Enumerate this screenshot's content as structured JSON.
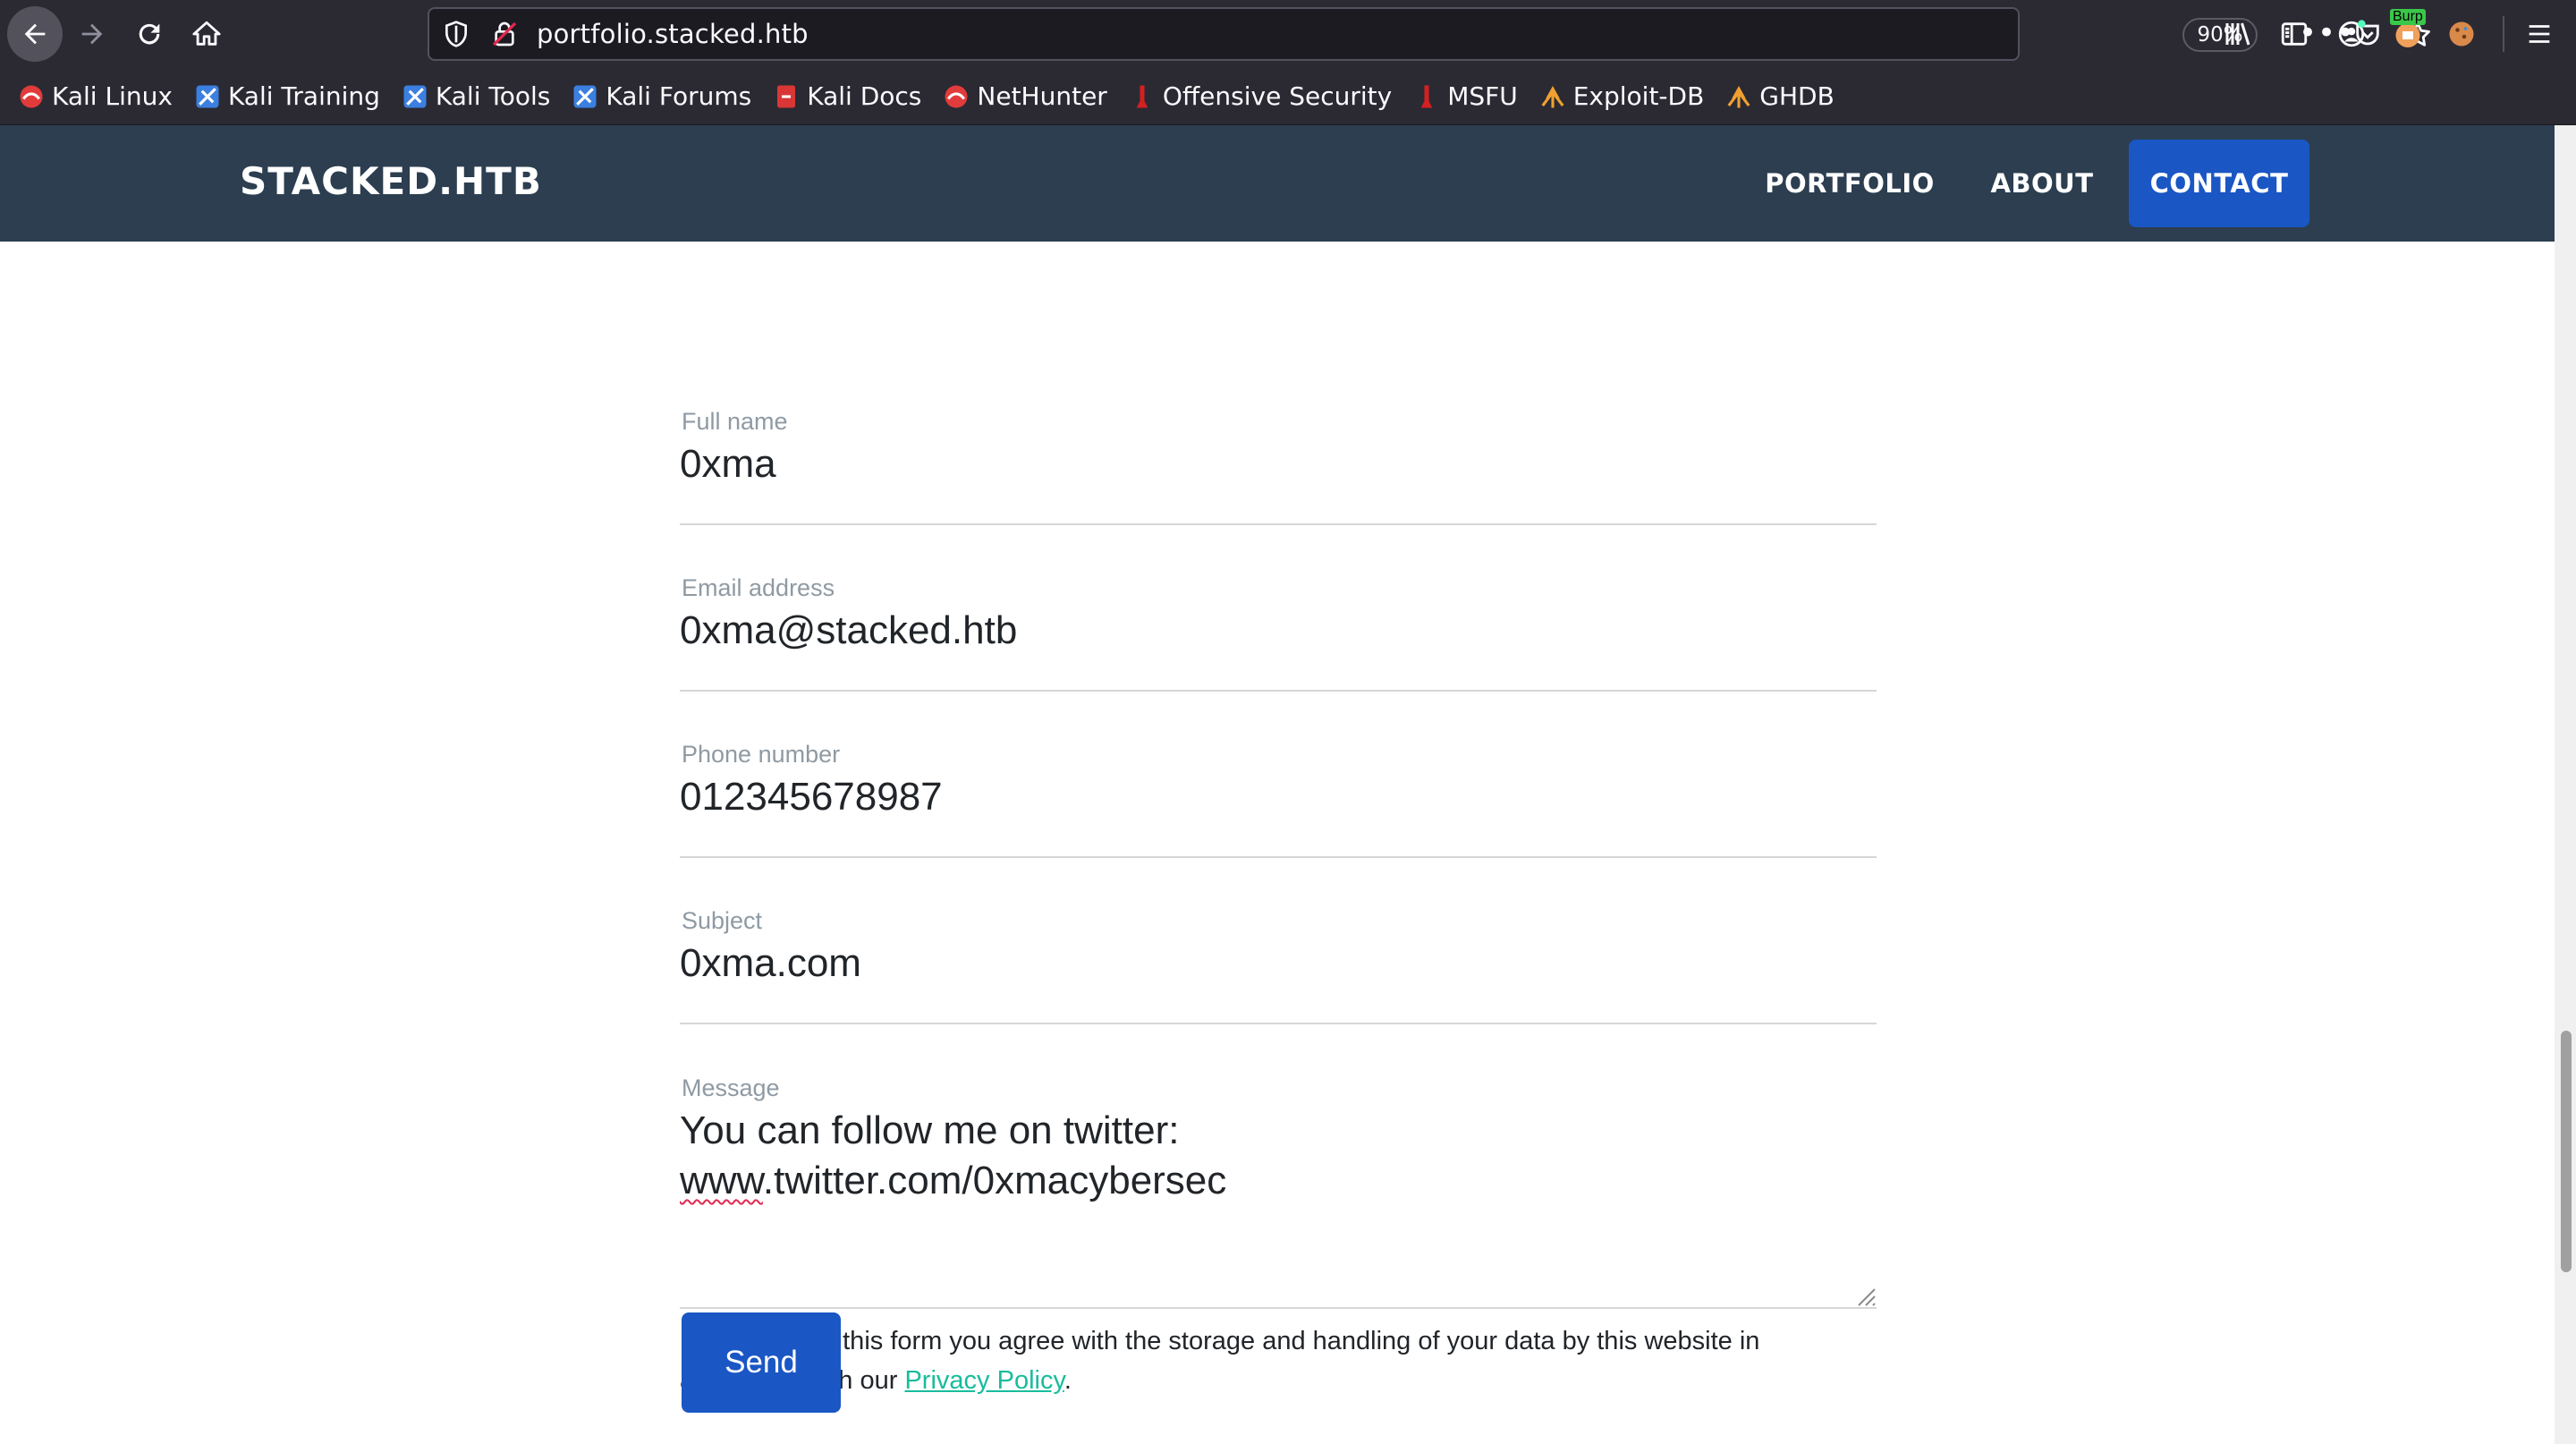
{
  "browser": {
    "url": "portfolio.stacked.htb",
    "zoom": "90%",
    "burp_badge": "Burp",
    "bookmarks": [
      {
        "label": "Kali Linux",
        "icon": "kali-dragon-icon"
      },
      {
        "label": "Kali Training",
        "icon": "kali-training-icon"
      },
      {
        "label": "Kali Tools",
        "icon": "kali-tools-icon"
      },
      {
        "label": "Kali Forums",
        "icon": "kali-forums-icon"
      },
      {
        "label": "Kali Docs",
        "icon": "kali-docs-icon"
      },
      {
        "label": "NetHunter",
        "icon": "nethunter-icon"
      },
      {
        "label": "Offensive Security",
        "icon": "offsec-icon"
      },
      {
        "label": "MSFU",
        "icon": "msfu-icon"
      },
      {
        "label": "Exploit-DB",
        "icon": "exploit-db-icon"
      },
      {
        "label": "GHDB",
        "icon": "ghdb-icon"
      }
    ]
  },
  "site": {
    "brand": "STACKED.HTB",
    "nav": [
      {
        "label": "PORTFOLIO"
      },
      {
        "label": "ABOUT"
      },
      {
        "label": "CONTACT"
      }
    ],
    "colors": {
      "navbar": "#2c3e50",
      "primary": "#1a56c4",
      "link": "#18bc9c"
    }
  },
  "form": {
    "full_name": {
      "label": "Full name",
      "value": "0xma"
    },
    "email": {
      "label": "Email address",
      "value": "0xma@stacked.htb"
    },
    "phone": {
      "label": "Phone number",
      "value": "012345678987"
    },
    "subject": {
      "label": "Subject",
      "value": "0xma.com"
    },
    "message": {
      "label": "Message",
      "line1": "You can follow me on twitter:",
      "line2_misspelled": "www",
      "line2_rest": ".twitter.com/0xmacybersec"
    },
    "consent": {
      "text": "By submitting this form you agree with the storage and handling of your data by this website in accorance with our ",
      "link": "Privacy Policy",
      "end": "."
    },
    "send_label": "Send"
  }
}
